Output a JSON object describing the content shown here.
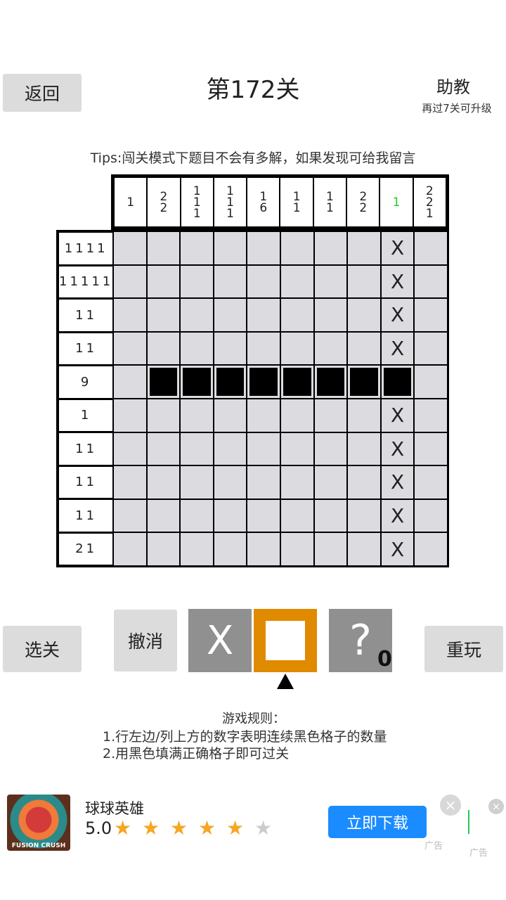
{
  "header": {
    "back_label": "返回",
    "title": "第172关",
    "assist_label": "助教",
    "assist_sub": "再过7关可升级",
    "tips": "Tips:闯关模式下题目不会有多解，如果发现可给我留言"
  },
  "puzzle": {
    "col_clues": [
      {
        "numbers": [
          "1"
        ],
        "done": false
      },
      {
        "numbers": [
          "2",
          "2"
        ],
        "done": false
      },
      {
        "numbers": [
          "1",
          "1",
          "1"
        ],
        "done": false
      },
      {
        "numbers": [
          "1",
          "1",
          "1"
        ],
        "done": false
      },
      {
        "numbers": [
          "1",
          "6"
        ],
        "done": false
      },
      {
        "numbers": [
          "1",
          "1"
        ],
        "done": false
      },
      {
        "numbers": [
          "1",
          "1"
        ],
        "done": false
      },
      {
        "numbers": [
          "2",
          "2"
        ],
        "done": false
      },
      {
        "numbers": [
          "1"
        ],
        "done": true
      },
      {
        "numbers": [
          "2",
          "2",
          "1"
        ],
        "done": false
      }
    ],
    "row_clues": [
      "1111",
      "11111",
      "11",
      "11",
      "9",
      "1",
      "11",
      "11",
      "11",
      "21"
    ],
    "grid": [
      [
        "",
        "",
        "",
        "",
        "",
        "",
        "",
        "",
        "X",
        ""
      ],
      [
        "",
        "",
        "",
        "",
        "",
        "",
        "",
        "",
        "X",
        ""
      ],
      [
        "",
        "",
        "",
        "",
        "",
        "",
        "",
        "",
        "X",
        ""
      ],
      [
        "",
        "",
        "",
        "",
        "",
        "",
        "",
        "",
        "X",
        ""
      ],
      [
        "",
        "#",
        "#",
        "#",
        "#",
        "#",
        "#",
        "#",
        "#",
        ""
      ],
      [
        "",
        "",
        "",
        "",
        "",
        "",
        "",
        "",
        "X",
        ""
      ],
      [
        "",
        "",
        "",
        "",
        "",
        "",
        "",
        "",
        "X",
        ""
      ],
      [
        "",
        "",
        "",
        "",
        "",
        "",
        "",
        "",
        "X",
        ""
      ],
      [
        "",
        "",
        "",
        "",
        "",
        "",
        "",
        "",
        "X",
        ""
      ],
      [
        "",
        "",
        "",
        "",
        "",
        "",
        "",
        "",
        "X",
        ""
      ]
    ]
  },
  "controls": {
    "select_level_label": "选关",
    "undo_label": "撤消",
    "tool_x_label": "X",
    "tool_hint_label": "?",
    "hint_count": "0",
    "replay_label": "重玩",
    "selected_tool": "fill"
  },
  "rules": {
    "title": "游戏规则：",
    "line1": "1.行左边/列上方的数字表明连续黑色格子的数量",
    "line2": "2.用黑色填满正确格子即可过关"
  },
  "ad": {
    "icon_text": "FUSION CRUSH",
    "name": "球球英雄",
    "rating": "5.0",
    "stars_filled": "★ ★ ★ ★ ★",
    "stars_empty": "★",
    "download_label": "立即下载",
    "close_symbol": "×",
    "tag1": "广告",
    "tag2": "广告"
  }
}
